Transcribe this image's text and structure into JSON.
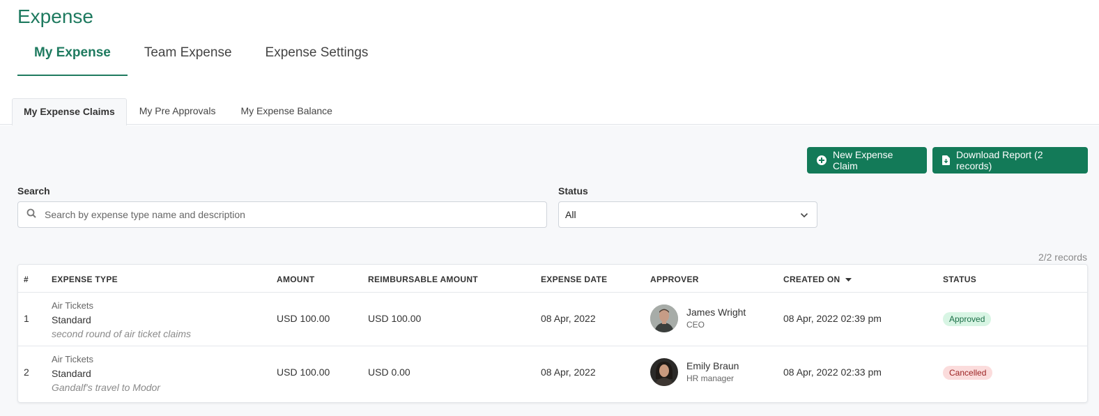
{
  "page": {
    "title": "Expense"
  },
  "main_tabs": [
    {
      "label": "My Expense",
      "active": true
    },
    {
      "label": "Team Expense",
      "active": false
    },
    {
      "label": "Expense Settings",
      "active": false
    }
  ],
  "sub_tabs": [
    {
      "label": "My Expense Claims",
      "active": true
    },
    {
      "label": "My Pre Approvals",
      "active": false
    },
    {
      "label": "My Expense Balance",
      "active": false
    }
  ],
  "actions": {
    "new_claim": "New Expense Claim",
    "download_report": "Download Report (2 records)"
  },
  "filters": {
    "search_label": "Search",
    "search_placeholder": "Search by expense type name and description",
    "search_value": "",
    "status_label": "Status",
    "status_value": "All"
  },
  "records_count": "2/2 records",
  "table": {
    "headers": {
      "num": "#",
      "type": "EXPENSE TYPE",
      "amount": "AMOUNT",
      "reimbursable": "REIMBURSABLE AMOUNT",
      "date": "EXPENSE DATE",
      "approver": "APPROVER",
      "created": "CREATED ON",
      "status": "STATUS"
    },
    "sort": {
      "column": "CREATED ON",
      "direction": "desc"
    },
    "rows": [
      {
        "num": "1",
        "category": "Air Tickets",
        "subtype": "Standard",
        "description": "second round of air ticket claims",
        "amount": "USD 100.00",
        "reimbursable": "USD 100.00",
        "date": "08 Apr, 2022",
        "approver_name": "James Wright",
        "approver_role": "CEO",
        "created": "08 Apr, 2022 02:39 pm",
        "status": "Approved"
      },
      {
        "num": "2",
        "category": "Air Tickets",
        "subtype": "Standard",
        "description": "Gandalf's travel to Modor",
        "amount": "USD 100.00",
        "reimbursable": "USD 0.00",
        "date": "08 Apr, 2022",
        "approver_name": "Emily Braun",
        "approver_role": "HR manager",
        "created": "08 Apr, 2022 02:33 pm",
        "status": "Cancelled"
      }
    ]
  },
  "colors": {
    "brand": "#1e7a5f",
    "button": "#137a58",
    "approved_bg": "#d8f5e4",
    "cancelled_bg": "#fbdcdc"
  }
}
